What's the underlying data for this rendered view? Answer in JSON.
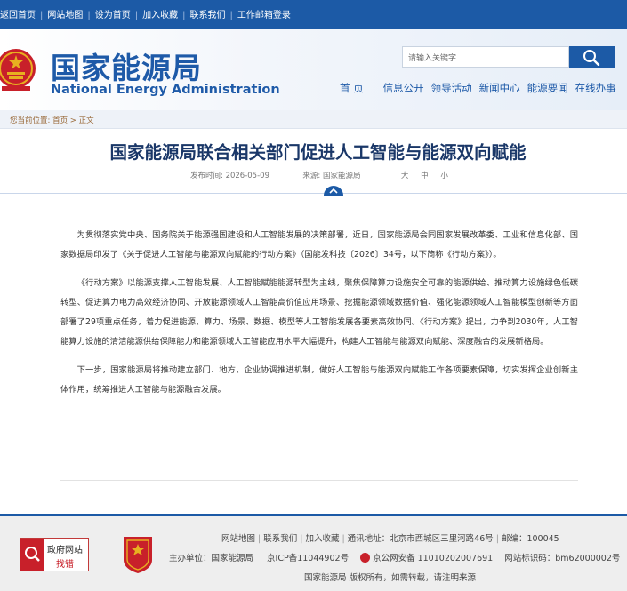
{
  "topbar": {
    "links": [
      "返回首页",
      "网站地图",
      "设为首页",
      "加入收藏",
      "联系我们",
      "工作邮箱登录"
    ]
  },
  "header": {
    "logo_cn": "国家能源局",
    "logo_en": "National Energy Administration",
    "search_placeholder": "请输入关键字",
    "nav": [
      "首 页",
      "信息公开",
      "领导活动",
      "新闻中心",
      "能源要闻",
      "在线办事"
    ]
  },
  "breadcrumb": {
    "prefix": "您当前位置:",
    "home": "首页",
    "sep": ">",
    "current": "正文"
  },
  "article": {
    "title": "国家能源局联合相关部门促进人工智能与能源双向赋能",
    "date_label": "发布时间:",
    "date": "2026-05-09",
    "source_label": "来源:",
    "source": "国家能源局",
    "font_sizes": [
      "大",
      "中",
      "小"
    ],
    "paragraphs": [
      "为贯彻落实党中央、国务院关于能源强国建设和人工智能发展的决策部署，近日，国家能源局会同国家发展改革委、工业和信息化部、国家数据局印发了《关于促进人工智能与能源双向赋能的行动方案》（国能发科技〔2026〕34号，以下简称《行动方案》）。",
      "《行动方案》以能源支撑人工智能发展、人工智能赋能能源转型为主线，聚焦保障算力设施安全可靠的能源供给、推动算力设施绿色低碳转型、促进算力电力高效经济协同、开放能源领域人工智能高价值应用场景、挖掘能源领域数据价值、强化能源领域人工智能模型创新等方面部署了29项重点任务，着力促进能源、算力、场景、数据、模型等人工智能发展各要素高效协同。《行动方案》提出，力争到2030年，人工智能算力设施的清洁能源供给保障能力和能源领域人工智能应用水平大幅提升，构建人工智能与能源双向赋能、深度融合的发展新格局。",
      "下一步，国家能源局将推动建立部门、地方、企业协调推进机制，做好人工智能与能源双向赋能工作各项要素保障，切实发挥企业创新主体作用，统筹推进人工智能与能源融合发展。"
    ]
  },
  "footer": {
    "badge_line1": "政府网站",
    "badge_line2": "找错",
    "links": [
      "网站地图",
      "联系我们",
      "加入收藏"
    ],
    "address": "通讯地址：北京市西城区三里河路46号",
    "postcode": "邮编：100045",
    "sponsor": "主办单位：国家能源局",
    "icp": "京ICP备11044902号",
    "police": "京公网安备 11010202007691",
    "site_code": "网站标识码：bm62000002号",
    "copyright": "国家能源局 版权所有，如需转载，请注明来源"
  },
  "colors": {
    "primary_blue": "#1c5aa6",
    "title_blue": "#1a3768",
    "emblem_red": "#c8202a",
    "emblem_gold": "#e8b020"
  }
}
